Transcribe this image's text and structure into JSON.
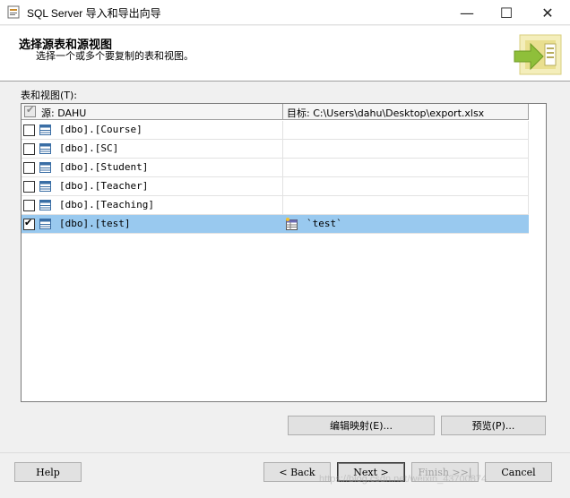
{
  "window": {
    "title": "SQL Server 导入和导出向导",
    "minimize_icon": "minimize-icon",
    "maximize_icon": "maximize-icon",
    "close_icon": "close-icon"
  },
  "header": {
    "title": "选择源表和源视图",
    "subtitle": "选择一个或多个要复制的表和视图。"
  },
  "tables_label": "表和视图(T):",
  "grid": {
    "source_header": "源: DAHU",
    "destination_header": "目标: C:\\Users\\dahu\\Desktop\\export.xlsx",
    "rows": [
      {
        "checked": false,
        "source": "[dbo].[Course]",
        "destination": ""
      },
      {
        "checked": false,
        "source": "[dbo].[SC]",
        "destination": ""
      },
      {
        "checked": false,
        "source": "[dbo].[Student]",
        "destination": ""
      },
      {
        "checked": false,
        "source": "[dbo].[Teacher]",
        "destination": ""
      },
      {
        "checked": false,
        "source": "[dbo].[Teaching]",
        "destination": ""
      },
      {
        "checked": true,
        "source": "[dbo].[test]",
        "destination": "`test`"
      }
    ]
  },
  "buttons": {
    "edit_mappings": "编辑映射(E)...",
    "preview": "预览(P)...",
    "help": "Help",
    "back": "< Back",
    "next": "Next >",
    "finish": "Finish >>|",
    "cancel": "Cancel"
  },
  "watermark": "https://blog.csdn.net/weixin_43700874"
}
